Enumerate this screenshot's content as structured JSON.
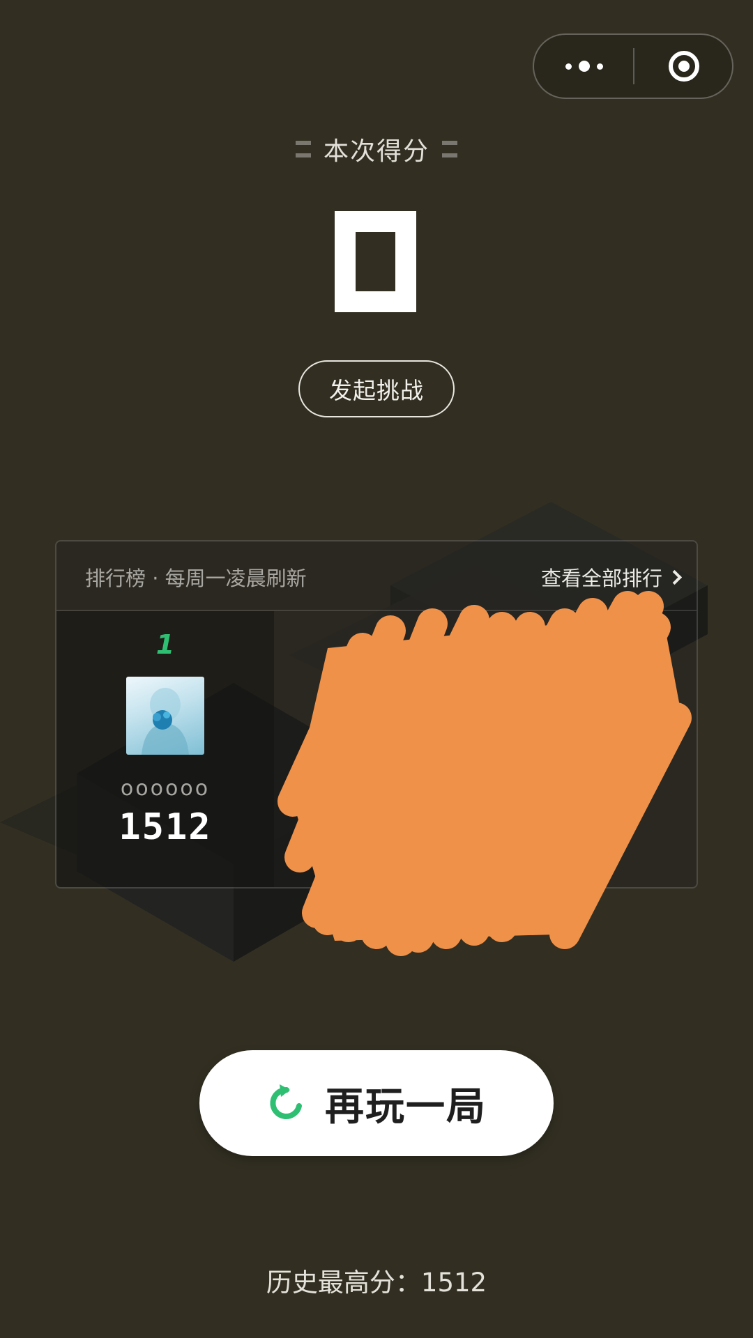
{
  "score_title": "本次得分",
  "current_score": "0",
  "challenge_button": "发起挑战",
  "leaderboard": {
    "title": "排行榜 · 每周一凌晨刷新",
    "view_all": "查看全部排行",
    "entries": [
      {
        "rank": "1",
        "nickname": "oooooo",
        "score": "1512"
      }
    ]
  },
  "play_again_button": "再玩一局",
  "history": {
    "label": "历史最高分：",
    "value": "1512"
  },
  "colors": {
    "background": "#322f22",
    "accent_green": "#2fbf73",
    "redaction_orange": "#f0914a"
  }
}
